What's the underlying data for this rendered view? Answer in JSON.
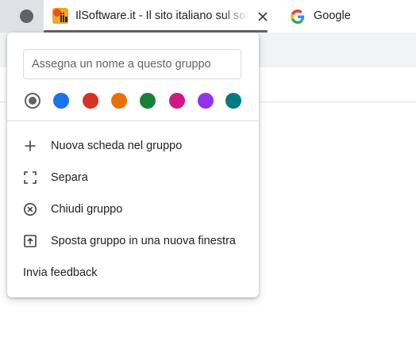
{
  "tabstrip": {
    "active_tab": {
      "title": "IlSoftware.it - Il sito italiano sul software",
      "favicon": "iis-favicon-icon"
    },
    "second_tab": {
      "title": "Google",
      "favicon": "google-g-icon"
    },
    "group_color": "#5f6368"
  },
  "popup": {
    "name_input": {
      "value": "",
      "placeholder": "Assegna un nome a questo gruppo"
    },
    "colors": [
      {
        "name": "grigio",
        "hex": "#5f6368",
        "selected": true
      },
      {
        "name": "blu",
        "hex": "#1a73e8",
        "selected": false
      },
      {
        "name": "rosso",
        "hex": "#d93025",
        "selected": false
      },
      {
        "name": "giallo",
        "hex": "#e8710a",
        "selected": false
      },
      {
        "name": "verde",
        "hex": "#188038",
        "selected": false
      },
      {
        "name": "rosa",
        "hex": "#d01884",
        "selected": false
      },
      {
        "name": "viola",
        "hex": "#9334e6",
        "selected": false
      },
      {
        "name": "ciano",
        "hex": "#007b83",
        "selected": false
      }
    ],
    "menu": [
      {
        "label": "Nuova scheda nel gruppo",
        "icon": "plus-icon"
      },
      {
        "label": "Separa",
        "icon": "ungroup-icon"
      },
      {
        "label": "Chiudi gruppo",
        "icon": "close-circle-icon"
      },
      {
        "label": "Sposta gruppo in una nuova finestra",
        "icon": "move-window-icon"
      },
      {
        "label": "Invia feedback",
        "icon": ""
      }
    ]
  }
}
